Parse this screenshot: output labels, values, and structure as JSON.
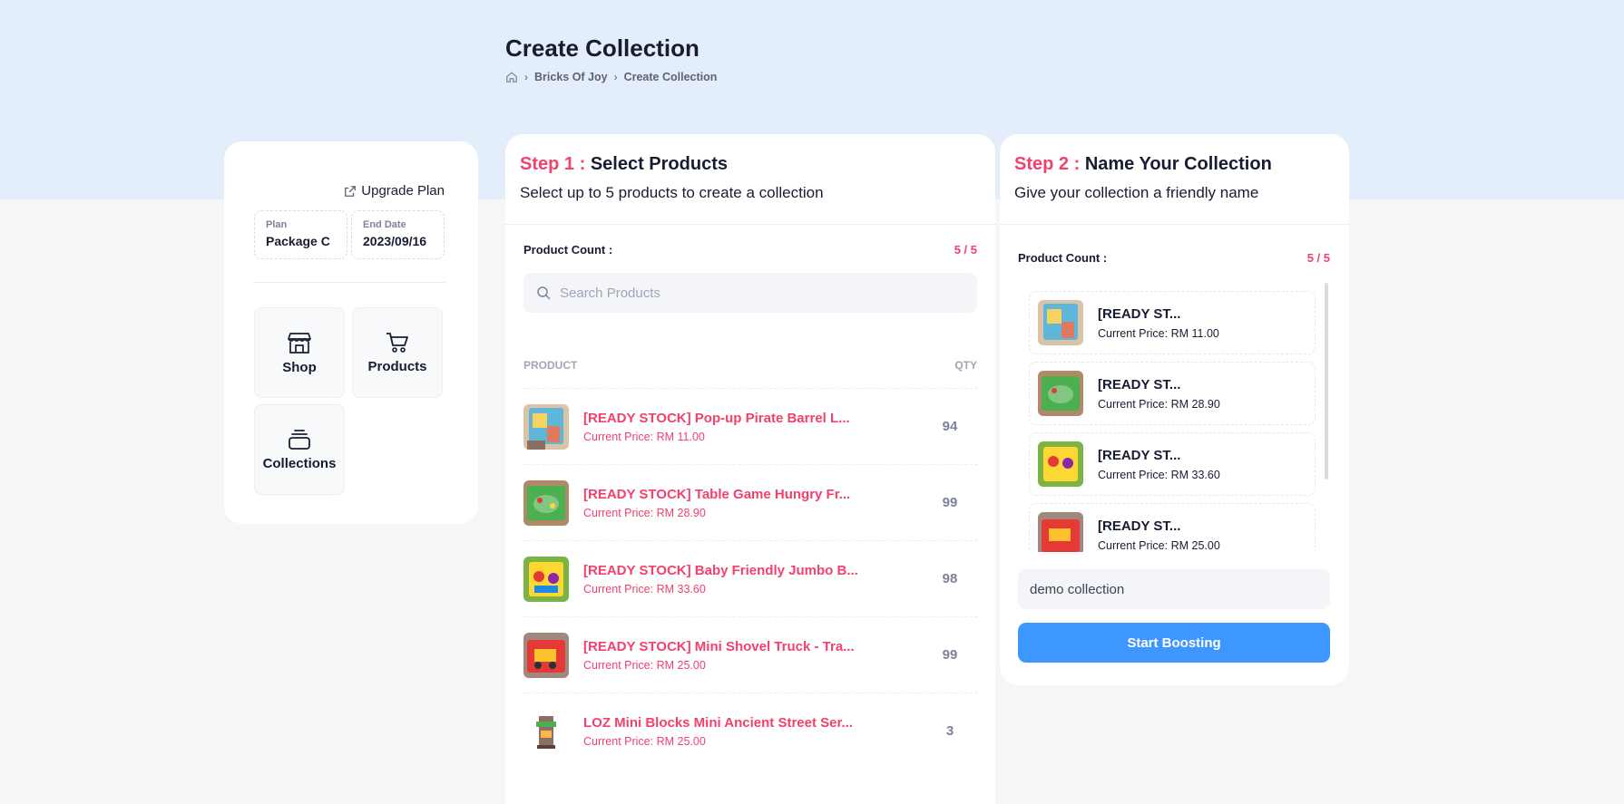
{
  "header": {
    "title": "Create Collection",
    "breadcrumb": [
      "Bricks Of Joy",
      "Create Collection"
    ]
  },
  "sidebar": {
    "upgrade_label": "Upgrade Plan",
    "plan_label": "Plan",
    "plan_value": "Package C",
    "end_date_label": "End Date",
    "end_date_value": "2023/09/16",
    "tiles": [
      {
        "label": "Shop",
        "icon": "shop-icon"
      },
      {
        "label": "Products",
        "icon": "cart-icon"
      },
      {
        "label": "Collections",
        "icon": "collections-icon"
      }
    ]
  },
  "step1": {
    "prefix": "Step 1 :",
    "title": "Select Products",
    "subtitle": "Select up to 5 products to create a collection",
    "count_label": "Product Count :",
    "count_value": "5 / 5",
    "search_placeholder": "Search Products",
    "col_product": "PRODUCT",
    "col_qty": "QTY",
    "products": [
      {
        "name": "[READY STOCK] Pop-up Pirate Barrel L...",
        "price": "Current Price: RM 11.00",
        "qty": "94"
      },
      {
        "name": "[READY STOCK] Table Game Hungry Fr...",
        "price": "Current Price: RM 28.90",
        "qty": "99"
      },
      {
        "name": "[READY STOCK] Baby Friendly Jumbo B...",
        "price": "Current Price: RM 33.60",
        "qty": "98"
      },
      {
        "name": "[READY STOCK] Mini Shovel Truck - Tra...",
        "price": "Current Price: RM 25.00",
        "qty": "99"
      },
      {
        "name": "LOZ Mini Blocks Mini Ancient Street Ser...",
        "price": "Current Price: RM 25.00",
        "qty": "3"
      }
    ]
  },
  "step2": {
    "prefix": "Step 2 :",
    "title": "Name Your Collection",
    "subtitle": "Give your collection a friendly name",
    "count_label": "Product Count :",
    "count_value": "5 / 5",
    "selected": [
      {
        "name": "[READY ST...",
        "price": "Current Price: RM 11.00"
      },
      {
        "name": "[READY ST...",
        "price": "Current Price: RM 28.90"
      },
      {
        "name": "[READY ST...",
        "price": "Current Price: RM 33.60"
      },
      {
        "name": "[READY ST...",
        "price": "Current Price: RM 25.00"
      }
    ],
    "collection_name": "demo collection",
    "button_label": "Start Boosting"
  },
  "colors": {
    "accent": "#f1416c",
    "primary": "#3e97ff",
    "header_band": "#e4eefa"
  }
}
